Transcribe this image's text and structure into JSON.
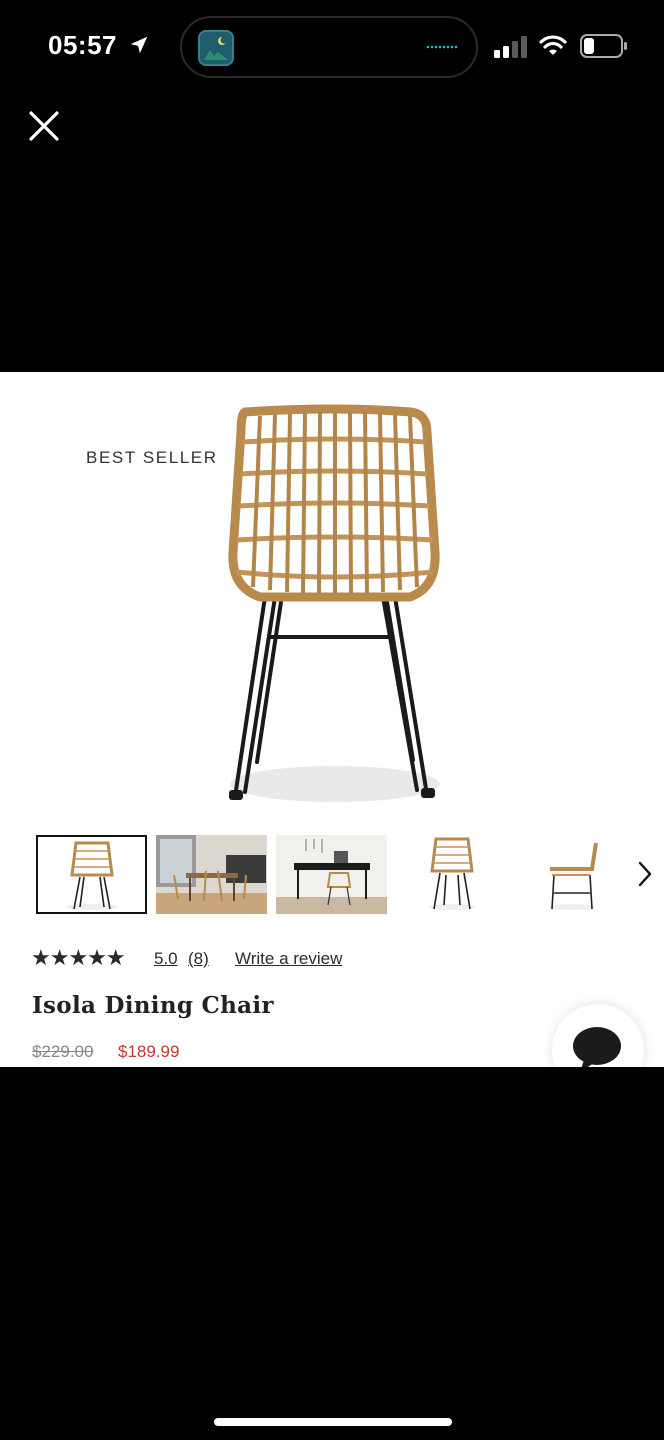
{
  "status_bar": {
    "time": "05:57",
    "icons": [
      "location-arrow-icon",
      "dynamic-island-app-icon",
      "signal-icon",
      "wifi-icon",
      "battery-icon"
    ],
    "accent": "#2bb4d4"
  },
  "close_icon": "close-icon",
  "product": {
    "badge": "BEST SELLER",
    "rating": {
      "stars_filled": 5,
      "stars_max": 5,
      "stars_text": "★★★★★",
      "score": "5.0",
      "count": "(8)",
      "write_review": "Write a review"
    },
    "title": "Isola Dining Chair",
    "price_original": "$229.00",
    "price_sale": "$189.99",
    "sale_color": "#c0392b",
    "thumbnails": [
      {
        "name": "front view",
        "selected": true
      },
      {
        "name": "dining room scene",
        "selected": false
      },
      {
        "name": "desk scene",
        "selected": false
      },
      {
        "name": "angled view",
        "selected": false
      },
      {
        "name": "side view",
        "selected": false
      }
    ]
  },
  "chat_icon": "chat-bubble-icon"
}
